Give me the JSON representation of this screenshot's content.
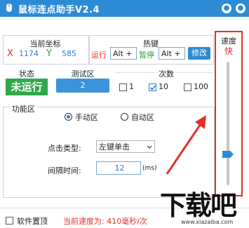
{
  "window": {
    "title": "鼠标连点助手V2.4"
  },
  "coords": {
    "header": "当前坐标",
    "x_label": "X",
    "x_value": "1174",
    "y_label": "Y",
    "y_value": "585"
  },
  "hotkey": {
    "header": "热键",
    "run_label": "运行",
    "run_value": "Alt +",
    "pause_label": "暂停",
    "pause_value": "Alt +",
    "modify_label": "修改"
  },
  "status": {
    "header": "状态",
    "value": "未运行"
  },
  "test_area": {
    "header": "测试区",
    "value": "2"
  },
  "times": {
    "header": "次数",
    "options": [
      {
        "label": "1",
        "checked": false
      },
      {
        "label": "10",
        "checked": true
      },
      {
        "label": "100",
        "checked": false
      }
    ]
  },
  "function": {
    "header": "功能区",
    "manual_label": "手动区",
    "manual_selected": true,
    "auto_label": "自动区",
    "auto_selected": false,
    "click_type_label": "点击类型:",
    "click_type_value": "左键单击",
    "interval_label": "间隔时间:",
    "interval_value": "12",
    "interval_unit": "(ms)"
  },
  "speed": {
    "header": "速度",
    "value_label": "快",
    "level": 0.25
  },
  "footer": {
    "pin_label": "软件置顶",
    "current_speed_text": "当前速度为: 410毫秒/次"
  },
  "watermark": {
    "text": "下载吧",
    "url": "www.xiazaiba.com"
  },
  "colors": {
    "accent": "#2d8bd6",
    "red": "#e0312a",
    "green": "#29a23b",
    "status_bg": "#2fa84a"
  }
}
